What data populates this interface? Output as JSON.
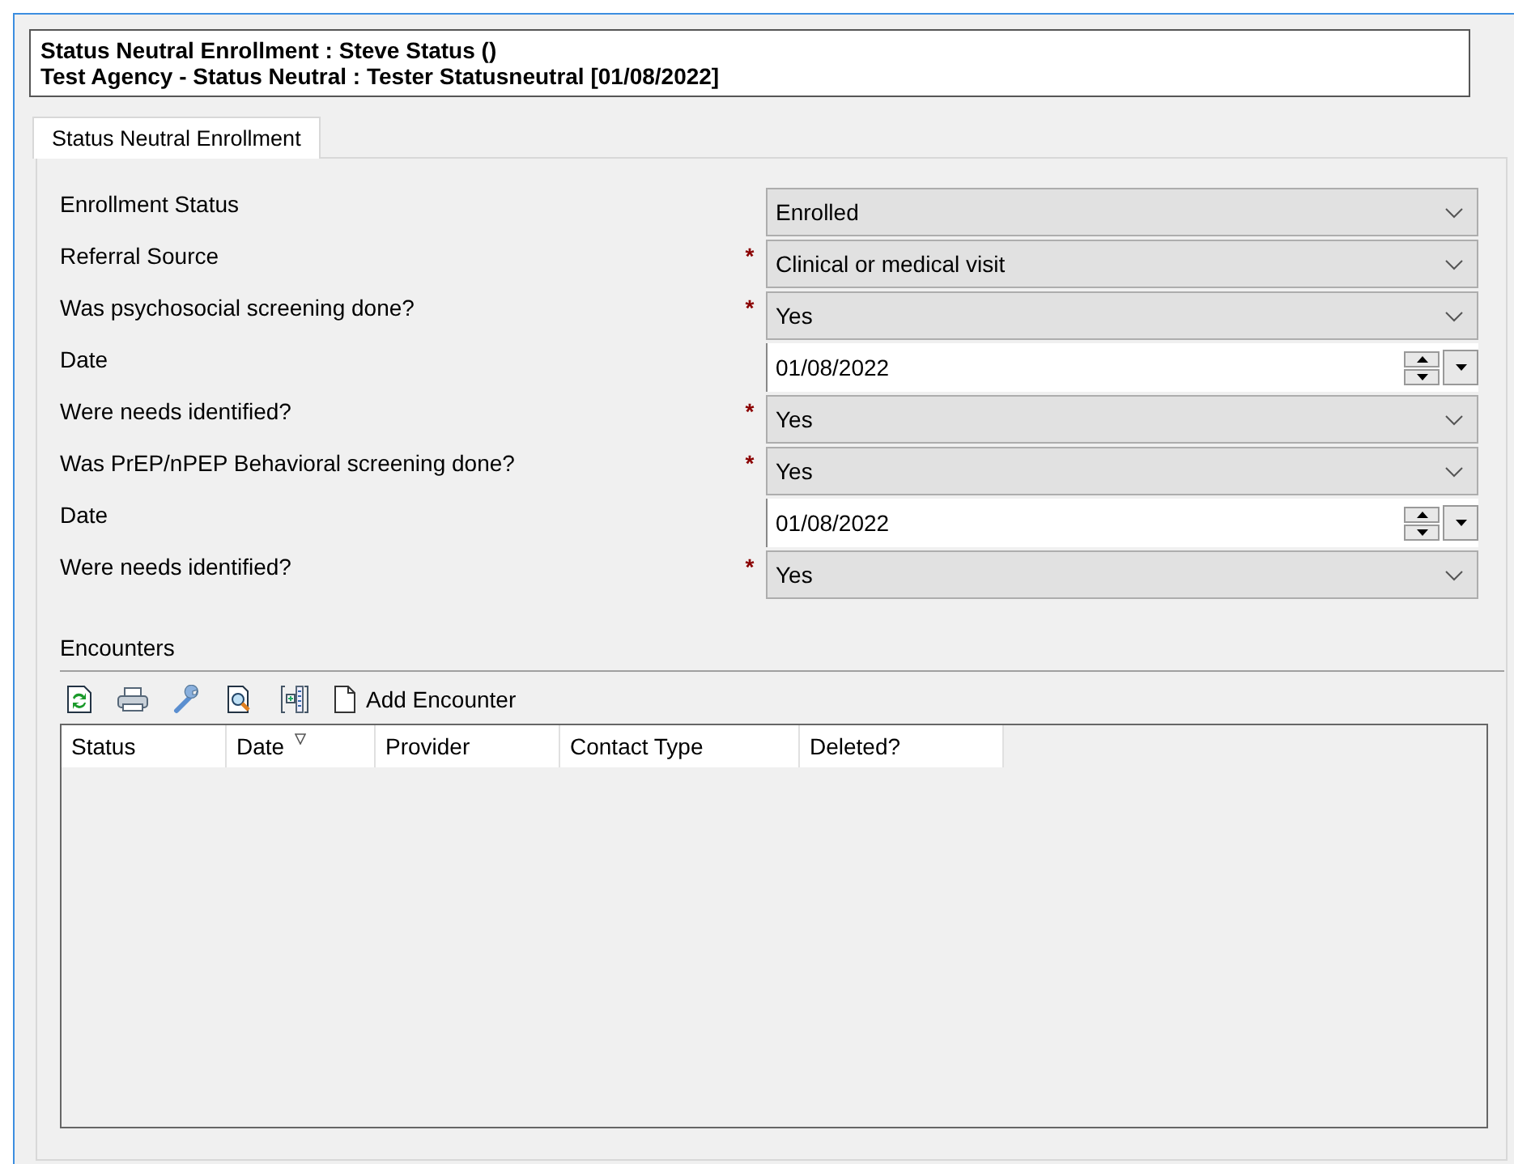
{
  "header": {
    "line_1": "Status Neutral Enrollment : Steve Status ()",
    "line_2": "Test Agency - Status Neutral :  Tester Statusneutral [01/08/2022]"
  },
  "tabs": [
    {
      "label": "Status Neutral Enrollment",
      "selected": true
    }
  ],
  "fields": [
    {
      "label": "Enrollment Status",
      "kind": "dropdown",
      "required": false,
      "value": "Enrolled"
    },
    {
      "label": "Referral Source",
      "kind": "dropdown",
      "required": true,
      "value": "Clinical or medical visit"
    },
    {
      "label": "Was psychosocial screening done?",
      "kind": "dropdown",
      "required": true,
      "value": "Yes"
    },
    {
      "label": "Date",
      "kind": "date",
      "required": false,
      "value": "01/08/2022"
    },
    {
      "label": "Were needs identified?",
      "kind": "dropdown",
      "required": true,
      "value": "Yes"
    },
    {
      "label": "Was PrEP/nPEP Behavioral screening done?",
      "kind": "dropdown",
      "required": true,
      "value": "Yes"
    },
    {
      "label": "Date",
      "kind": "date",
      "required": false,
      "value": "01/08/2022"
    },
    {
      "label": "Were needs identified?",
      "kind": "dropdown",
      "required": true,
      "value": "Yes"
    }
  ],
  "required_mark": "*",
  "encounters": {
    "title": "Encounters",
    "toolbar": [
      {
        "kind": "refresh"
      },
      {
        "kind": "print"
      },
      {
        "kind": "wrench"
      },
      {
        "kind": "preview"
      },
      {
        "kind": "columns"
      },
      {
        "kind": "page",
        "label": "Add Encounter"
      }
    ],
    "columns": [
      {
        "label": "Status",
        "sorted": false
      },
      {
        "label": "Date",
        "sorted": true
      },
      {
        "label": "Provider",
        "sorted": false
      },
      {
        "label": "Contact Type",
        "sorted": false
      },
      {
        "label": "Deleted?",
        "sorted": false
      }
    ]
  }
}
